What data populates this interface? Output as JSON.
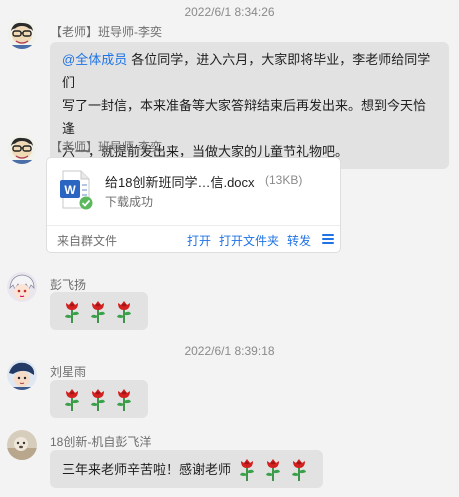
{
  "timestamps": [
    "2022/6/1 8:34:26",
    "2022/6/1 8:39:18"
  ],
  "messages": [
    {
      "sender": "【老师】班导师-李奕",
      "mention": "@全体成员",
      "lines": [
        "各位同学，进入六月，大家即将毕业，李老师给同学们",
        "写了一封信，本来准备等大家答辩结束后再发出来。想到今天恰逢",
        "六一，就提前发出来，当做大家的儿童节礼物吧。"
      ]
    },
    {
      "sender": "【老师】班导师-李奕",
      "file": {
        "name": "给18创新班同学…信.docx",
        "size": "(13KB)",
        "status": "下载成功",
        "source": "来自群文件",
        "actions": [
          "打开",
          "打开文件夹",
          "转发"
        ],
        "icon": "word-doc-icon"
      }
    },
    {
      "sender": "彭飞扬",
      "emoji": "rose",
      "count": 3
    },
    {
      "sender": "刘星雨",
      "emoji": "rose",
      "count": 3
    },
    {
      "sender": "18创新-机自彭飞洋",
      "text": "三年来老师辛苦啦！感谢老师",
      "emoji": "rose",
      "count": 3
    }
  ]
}
